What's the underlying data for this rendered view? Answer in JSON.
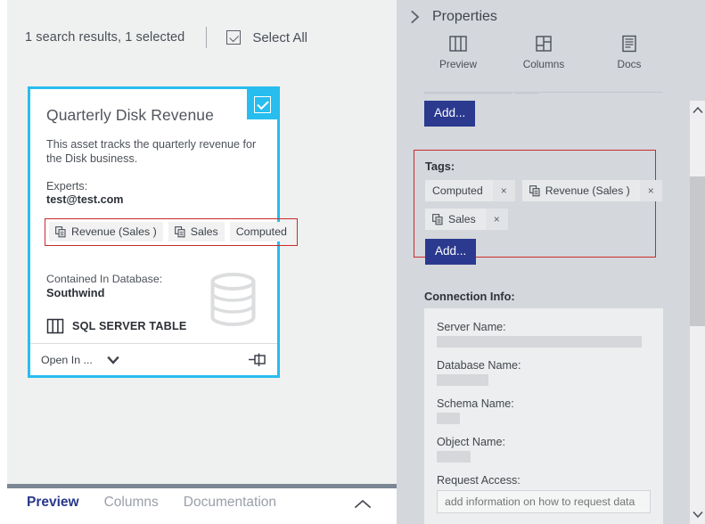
{
  "left": {
    "results_text": "1 search results, 1 selected",
    "select_all_label": "Select All",
    "card": {
      "title": "Quarterly Disk Revenue",
      "description": "This asset tracks the quarterly revenue for the Disk business.",
      "experts_label": "Experts:",
      "experts_value": "test@test.com",
      "tags": [
        {
          "label": "Revenue (Sales )",
          "icon": "tag-copy-icon",
          "has_icon": true
        },
        {
          "label": "Sales",
          "icon": "tag-copy-icon",
          "has_icon": true
        },
        {
          "label": "Computed",
          "icon": "",
          "has_icon": false
        }
      ],
      "contained_label": "Contained In Database:",
      "contained_value": "Southwind",
      "type_label": "SQL SERVER TABLE",
      "type_icon": "table-icon",
      "db_icon": "database-cylinder-icon",
      "footer_open_in": "Open In ...",
      "footer_caret_icon": "chevron-down-icon",
      "footer_pin_icon": "pin-icon",
      "selected": true,
      "accent_color": "#27bdee",
      "tag_highlight_color": "#cc2a2a"
    }
  },
  "bottom_tabs": {
    "items": [
      {
        "label": "Preview",
        "active": true
      },
      {
        "label": "Columns",
        "active": false
      },
      {
        "label": "Documentation",
        "active": false
      }
    ],
    "collapse_icon": "chevron-up-icon",
    "active_color": "#29388a"
  },
  "right": {
    "expand_icon": "chevron-right-icon",
    "title": "Properties",
    "toolbar": [
      {
        "label": "Preview",
        "icon": "preview-table-icon"
      },
      {
        "label": "Columns",
        "icon": "columns-layout-icon"
      },
      {
        "label": "Docs",
        "icon": "document-icon"
      }
    ],
    "add_button_top": "Add...",
    "tags_section": {
      "label": "Tags:",
      "highlight_color": "#cc2a2a",
      "chips": [
        {
          "label": "Computed",
          "has_icon": false,
          "remove": "×"
        },
        {
          "label": "Revenue (Sales )",
          "has_icon": true,
          "remove": "×"
        },
        {
          "label": "Sales",
          "has_icon": true,
          "remove": "×"
        }
      ],
      "add_button": "Add..."
    },
    "connection": {
      "title": "Connection Info:",
      "fields": [
        {
          "label": "Server Name:",
          "value": "",
          "redacted": true
        },
        {
          "label": "Database Name:",
          "value": "",
          "redacted": true
        },
        {
          "label": "Schema Name:",
          "value": "",
          "redacted": true
        },
        {
          "label": "Object Name:",
          "value": "",
          "redacted": true
        }
      ],
      "request_access_label": "Request Access:",
      "request_access_placeholder": "add information on how to request data"
    },
    "scrollbar": {
      "up_icon": "chevron-up-icon",
      "down_icon": "chevron-down-icon"
    },
    "button_color": "#2b3a8f",
    "panel_color": "#d4d7dc"
  }
}
